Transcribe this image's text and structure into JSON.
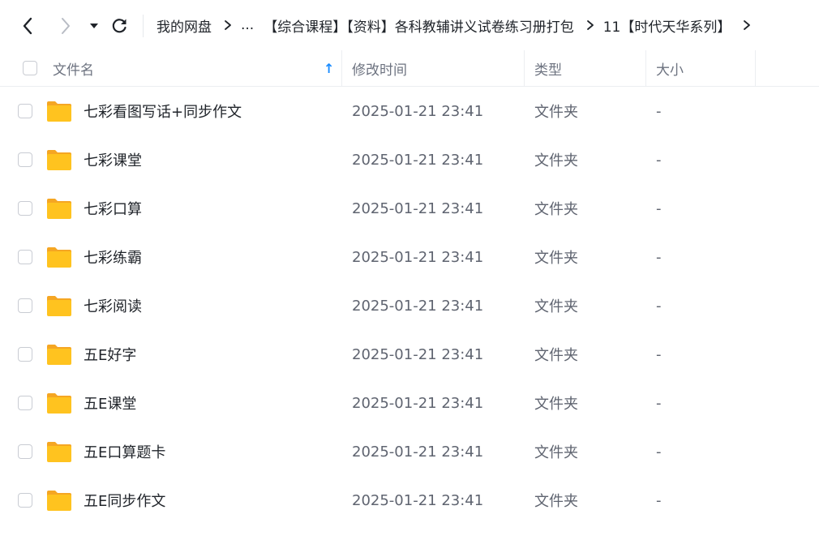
{
  "nav": {
    "back_icon": "chevron-left-icon",
    "forward_icon": "chevron-right-icon",
    "dropdown_icon": "caret-down-icon",
    "refresh_icon": "refresh-icon"
  },
  "breadcrumb": {
    "items": [
      "我的网盘",
      "...",
      "【综合课程】【资料】各科教辅讲义试卷练习册打包",
      "11【时代天华系列】"
    ]
  },
  "table": {
    "columns": {
      "name": "文件名",
      "modified": "修改时间",
      "type": "类型",
      "size": "大小"
    },
    "sort_indicator": "↑",
    "rows": [
      {
        "name": "七彩看图写话+同步作文",
        "modified": "2025-01-21 23:41",
        "type": "文件夹",
        "size": "-"
      },
      {
        "name": "七彩课堂",
        "modified": "2025-01-21 23:41",
        "type": "文件夹",
        "size": "-"
      },
      {
        "name": "七彩口算",
        "modified": "2025-01-21 23:41",
        "type": "文件夹",
        "size": "-"
      },
      {
        "name": "七彩练霸",
        "modified": "2025-01-21 23:41",
        "type": "文件夹",
        "size": "-"
      },
      {
        "name": "七彩阅读",
        "modified": "2025-01-21 23:41",
        "type": "文件夹",
        "size": "-"
      },
      {
        "name": "五E好字",
        "modified": "2025-01-21 23:41",
        "type": "文件夹",
        "size": "-"
      },
      {
        "name": "五E课堂",
        "modified": "2025-01-21 23:41",
        "type": "文件夹",
        "size": "-"
      },
      {
        "name": "五E口算题卡",
        "modified": "2025-01-21 23:41",
        "type": "文件夹",
        "size": "-"
      },
      {
        "name": "五E同步作文",
        "modified": "2025-01-21 23:41",
        "type": "文件夹",
        "size": "-"
      }
    ]
  },
  "colors": {
    "accent": "#1a8cff",
    "folder": "#ffc31f",
    "folder_back": "#f5a623"
  }
}
